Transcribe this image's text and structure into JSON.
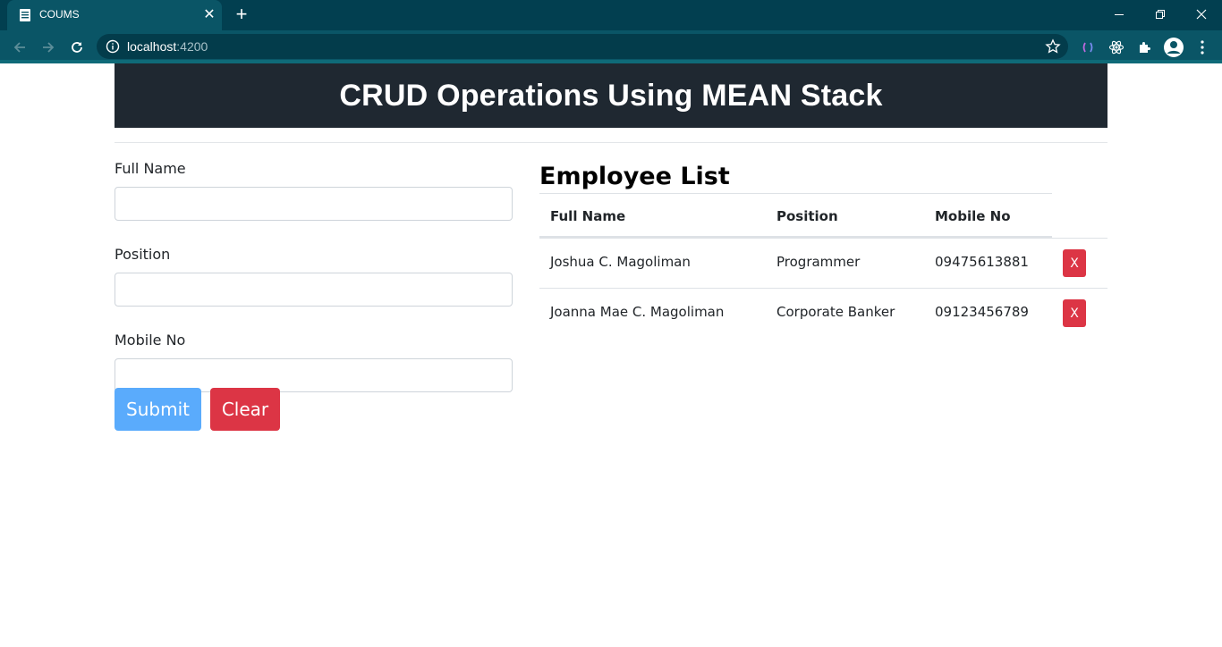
{
  "browser": {
    "tab_title": "COUMS",
    "url_host": "localhost",
    "url_port": ":4200"
  },
  "header": {
    "title": "CRUD Operations Using MEAN Stack"
  },
  "form": {
    "full_name_label": "Full Name",
    "full_name_value": "",
    "position_label": "Position",
    "position_value": "",
    "mobile_label": "Mobile No",
    "mobile_value": "",
    "submit_label": "Submit",
    "clear_label": "Clear"
  },
  "employee_list": {
    "title": "Employee List",
    "columns": [
      "Full Name",
      "Position",
      "Mobile No"
    ],
    "rows": [
      {
        "full_name": "Joshua C. Magoliman",
        "position": "Programmer",
        "mobile": "09475613881",
        "delete_label": "X"
      },
      {
        "full_name": "Joanna Mae C. Magoliman",
        "position": "Corporate Banker",
        "mobile": "09123456789",
        "delete_label": "X"
      }
    ]
  },
  "colors": {
    "tabbar": "#023f50",
    "toolbar": "#0a5566",
    "jumbotron": "#1f2831",
    "submit": "#5aabfc",
    "danger": "#dc3545"
  }
}
